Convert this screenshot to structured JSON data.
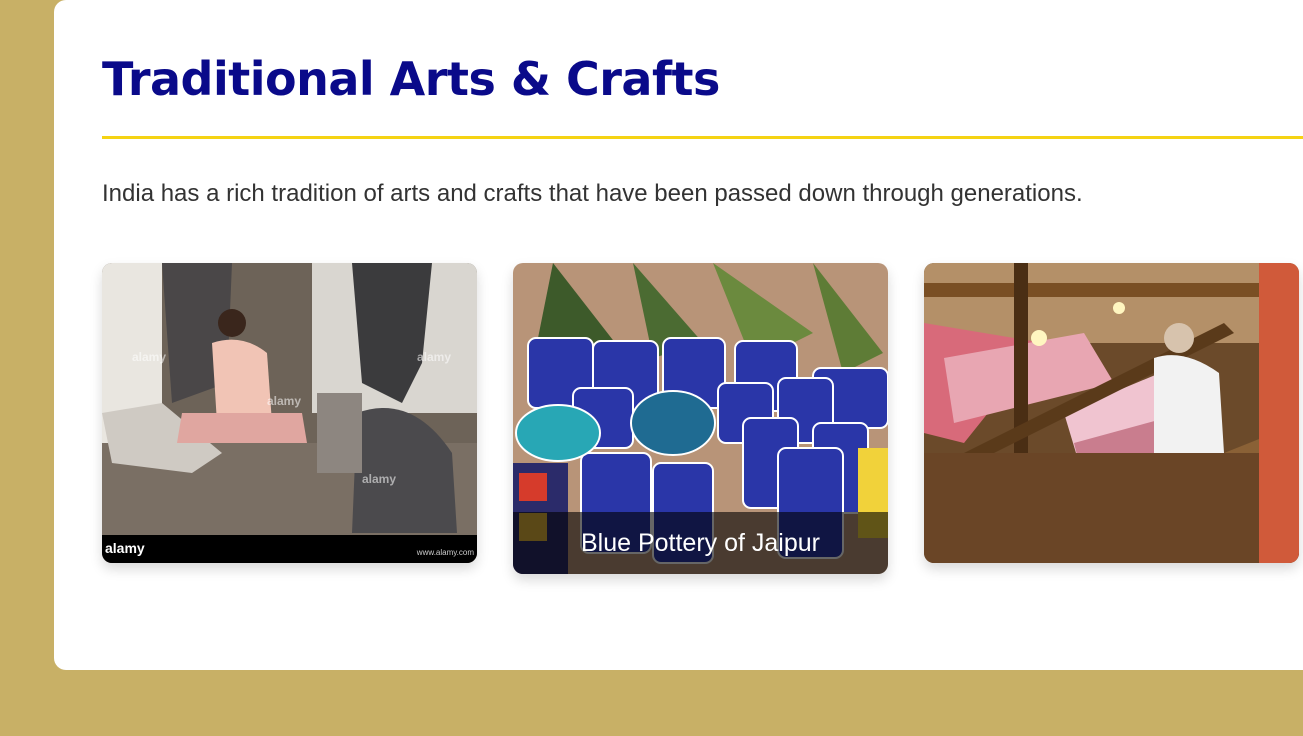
{
  "section": {
    "title": "Traditional Arts & Crafts",
    "intro": "India has a rich tradition of arts and crafts that have been passed down through generations."
  },
  "cards": [
    {
      "caption": "",
      "image": "stone-carving-photo",
      "watermark": "alamy",
      "url": "www.alamy.com"
    },
    {
      "caption": "Blue Pottery of Jaipur",
      "image": "blue-pottery-photo"
    },
    {
      "caption": "",
      "image": "handloom-weaving-photo"
    }
  ],
  "colors": {
    "background": "#c8b066",
    "title": "#0a0a8a",
    "accent_rule": "#f5d313",
    "text": "#333333"
  }
}
